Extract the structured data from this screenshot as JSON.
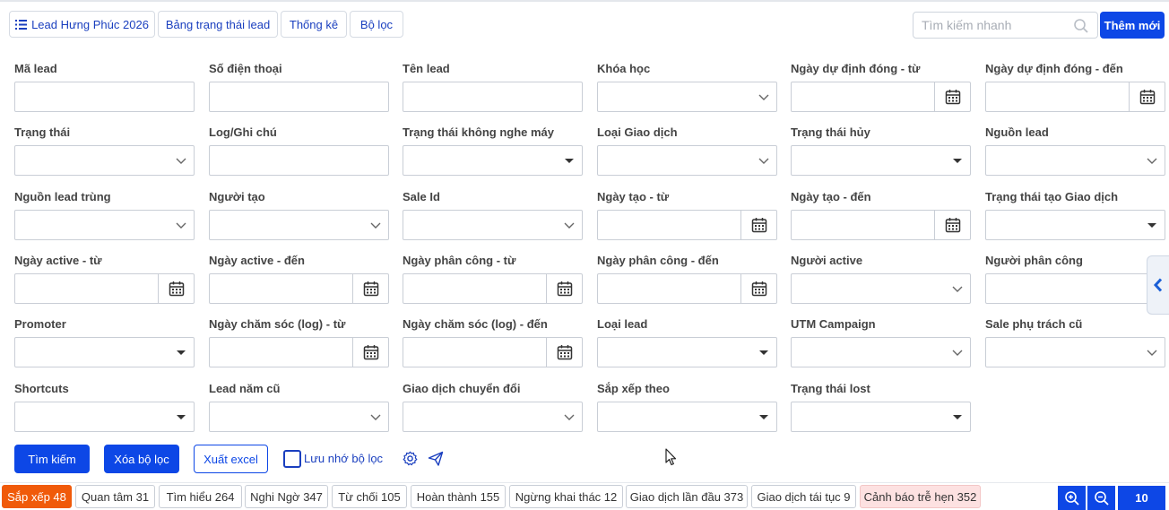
{
  "tabs": [
    {
      "label": "Lead Hưng Phúc 2026",
      "icon": "list-icon"
    },
    {
      "label": "Bảng trạng thái lead"
    },
    {
      "label": "Thống kê"
    },
    {
      "label": "Bộ lọc"
    }
  ],
  "search": {
    "placeholder": "Tìm kiếm nhanh"
  },
  "add_new_label": "Thêm mới",
  "fields": {
    "ma_lead": "Mã lead",
    "so_dien_thoai": "Số điện thoại",
    "ten_lead": "Tên lead",
    "khoa_hoc": "Khóa học",
    "ngay_du_dinh_dong_tu": "Ngày dự định đóng - từ",
    "ngay_du_dinh_dong_den": "Ngày dự định đóng - đến",
    "trang_thai": "Trạng thái",
    "log_ghi_chu": "Log/Ghi chú",
    "trang_thai_khong_nghe_may": "Trạng thái không nghe máy",
    "loai_giao_dich": "Loại Giao dịch",
    "trang_thai_huy": "Trạng thái hủy",
    "nguon_lead": "Nguồn lead",
    "nguon_lead_trung": "Nguồn lead trùng",
    "nguoi_tao": "Người tạo",
    "sale_id": "Sale Id",
    "ngay_tao_tu": "Ngày tạo - từ",
    "ngay_tao_den": "Ngày tạo - đến",
    "trang_thai_tao_giao_dich": "Trạng thái tạo Giao dịch",
    "ngay_active_tu": "Ngày active - từ",
    "ngay_active_den": "Ngày active - đến",
    "ngay_phan_cong_tu": "Ngày phân công - từ",
    "ngay_phan_cong_den": "Ngày phân công - đến",
    "nguoi_active": "Người active",
    "nguoi_phan_cong": "Người phân công",
    "promoter": "Promoter",
    "ngay_cham_soc_tu": "Ngày chăm sóc (log) - từ",
    "ngay_cham_soc_den": "Ngày chăm sóc (log) - đến",
    "loai_lead": "Loại lead",
    "utm_campaign": "UTM Campaign",
    "sale_phu_trach_cu": "Sale phụ trách cũ",
    "shortcuts": "Shortcuts",
    "lead_nam_cu": "Lead năm cũ",
    "giao_dich_chuyen_doi": "Giao dịch chuyển đổi",
    "sap_xep_theo": "Sắp xếp theo",
    "trang_thai_lost": "Trạng thái lost"
  },
  "actions": {
    "search": "Tìm kiếm",
    "clear": "Xóa bộ lọc",
    "export": "Xuất excel",
    "remember": "Lưu nhớ bộ lọc"
  },
  "status_chips": [
    {
      "label": "Sắp xếp 48",
      "state": "active"
    },
    {
      "label": "Quan tâm 31"
    },
    {
      "label": "Tìm hiểu 264"
    },
    {
      "label": "Nghi Ngờ 347"
    },
    {
      "label": "Từ chối 105"
    },
    {
      "label": "Hoàn thành 155"
    },
    {
      "label": "Ngừng khai thác 12"
    },
    {
      "label": "Giao dịch lần đầu 373"
    },
    {
      "label": "Giao dịch tái tục 9"
    },
    {
      "label": "Cảnh báo trễ hẹn 352",
      "state": "warning"
    }
  ],
  "page_size": "10",
  "colors": {
    "primary": "#0d47e6",
    "active_chip": "#f05a0a",
    "warning_chip": "#fde1e1"
  }
}
